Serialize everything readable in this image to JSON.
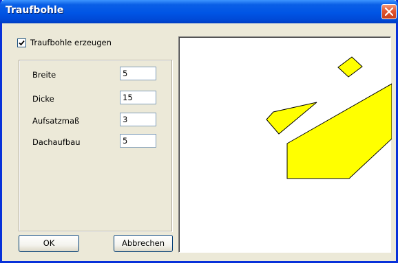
{
  "window": {
    "title": "Traufbohle"
  },
  "checkbox": {
    "label": "Traufbohle erzeugen",
    "checked": true
  },
  "fields": [
    {
      "label": "Breite",
      "value": "5"
    },
    {
      "label": "Dicke",
      "value": "15"
    },
    {
      "label": "Aufsatzmaß",
      "value": "3"
    },
    {
      "label": "Dachaufbau",
      "value": "5"
    }
  ],
  "buttons": {
    "ok_label": "OK",
    "cancel_label": "Abbrechen"
  },
  "preview": {
    "fill_color": "#ffff00",
    "stroke_color": "#000000"
  },
  "colors": {
    "titlebar": "#0055e5",
    "dialog_bg": "#ece9d8",
    "close_button": "#e2552f"
  }
}
